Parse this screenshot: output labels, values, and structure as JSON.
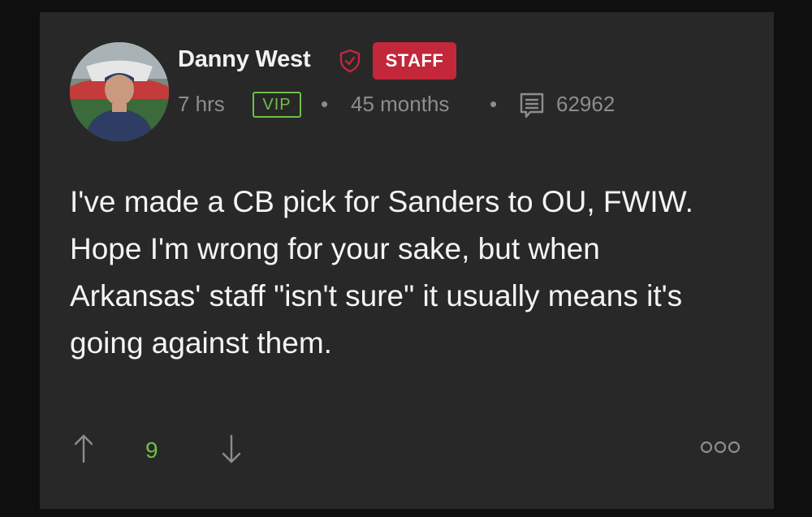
{
  "post": {
    "author": "Danny West",
    "role_badge": "STAFF",
    "time_ago": "7 hrs",
    "membership_badge": "VIP",
    "separator": "•",
    "member_duration": "45 months",
    "message_count": "62962",
    "body": "I've made a CB pick for Sanders to OU, FWIW. Hope I'm wrong for your sake, but when Arkansas' staff \"isn't sure\" it usually means it's going against them.",
    "vote_score": "9"
  },
  "icons": {
    "verified": "shield-check-icon",
    "messages": "message-lines-icon",
    "upvote": "arrow-up-icon",
    "downvote": "arrow-down-icon",
    "more": "more-options-icon"
  },
  "colors": {
    "staff_badge": "#c3273a",
    "vip_badge": "#6fbf4a",
    "vote_score": "#6fbf4a",
    "card_background": "#292828"
  }
}
